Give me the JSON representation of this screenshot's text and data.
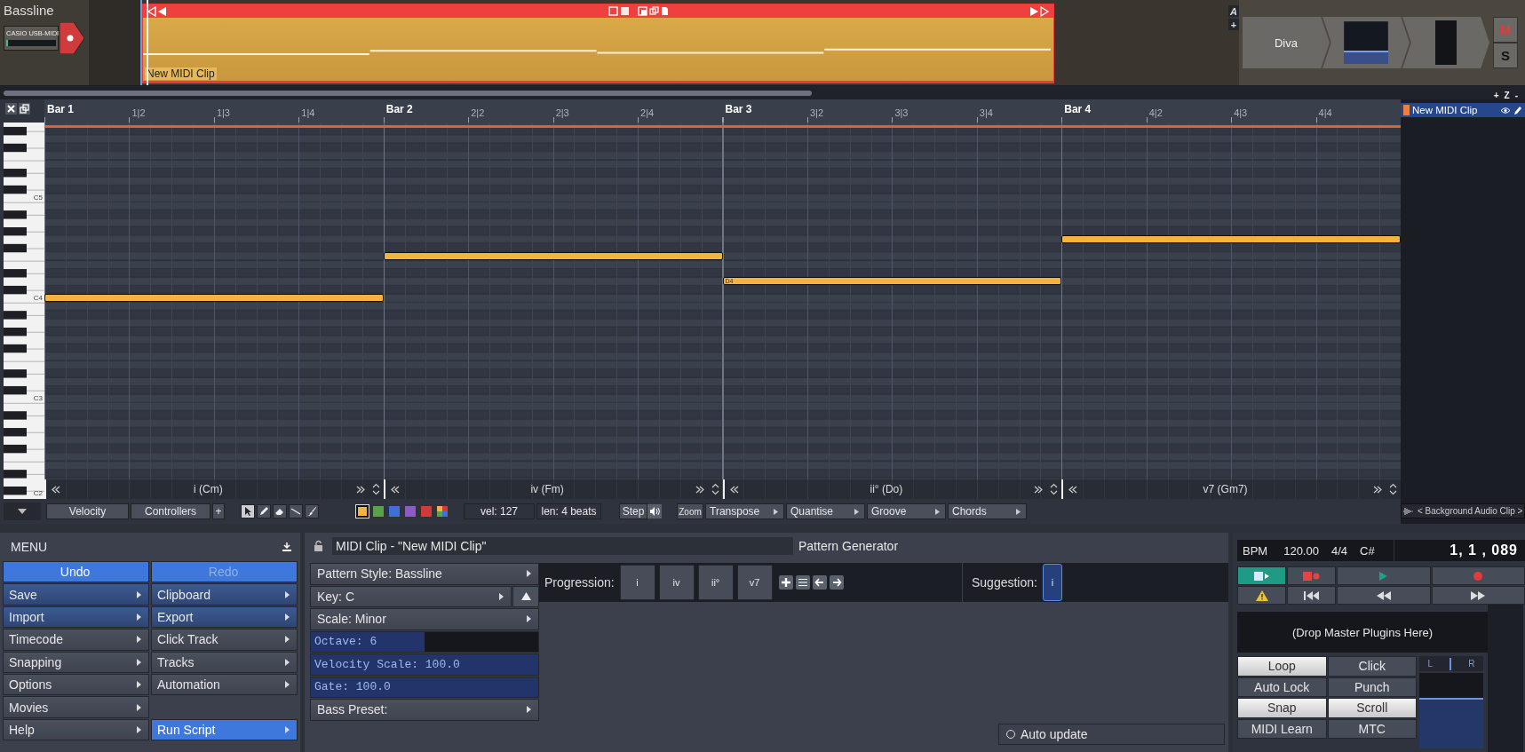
{
  "track": {
    "name": "Bassline",
    "input": "CASIO USB-MIDI",
    "armed": true,
    "clip": {
      "name": "New MIDI Clip",
      "selected": true
    },
    "track_tools": [
      "A",
      "+"
    ],
    "plugins": [
      {
        "kind": "instrument",
        "name": "Diva"
      },
      {
        "kind": "volume"
      },
      {
        "kind": "meter"
      }
    ],
    "mute": {
      "label": "M",
      "on": true
    },
    "solo": {
      "label": "S",
      "on": false
    }
  },
  "zoom_controls": [
    "+",
    "Z",
    "-"
  ],
  "ruler": [
    {
      "label": "Bar 1",
      "kind": "bar"
    },
    {
      "label": "1|2",
      "kind": "beat"
    },
    {
      "label": "1|3",
      "kind": "beat"
    },
    {
      "label": "1|4",
      "kind": "beat"
    },
    {
      "label": "Bar 2",
      "kind": "bar"
    },
    {
      "label": "2|2",
      "kind": "beat"
    },
    {
      "label": "2|3",
      "kind": "beat"
    },
    {
      "label": "2|4",
      "kind": "beat"
    },
    {
      "label": "Bar 3",
      "kind": "bar"
    },
    {
      "label": "3|2",
      "kind": "beat"
    },
    {
      "label": "3|3",
      "kind": "beat"
    },
    {
      "label": "3|4",
      "kind": "beat"
    },
    {
      "label": "Bar 4",
      "kind": "bar"
    },
    {
      "label": "4|2",
      "kind": "beat"
    },
    {
      "label": "4|3",
      "kind": "beat"
    },
    {
      "label": "4|4",
      "kind": "beat"
    }
  ],
  "piano_labels": [
    "C5",
    "C4",
    "C3",
    "C2"
  ],
  "note_label": "D4",
  "chords": [
    "i (Cm)",
    "iv (Fm)",
    "ii° (Do)",
    "v7 (Gm7)"
  ],
  "toolbar": {
    "lanes": [
      "Velocity",
      "Controllers",
      "+"
    ],
    "tools": [
      {
        "kind": "pointer",
        "selected": true
      },
      {
        "kind": "pencil",
        "selected": false
      },
      {
        "kind": "eraser",
        "selected": false
      },
      {
        "kind": "line",
        "selected": false
      },
      {
        "kind": "brush",
        "selected": false
      }
    ],
    "swatches": [
      {
        "kind": "solid",
        "color": "#f2b43e",
        "selected": true
      },
      {
        "kind": "solid",
        "color": "#5aa14c",
        "selected": false
      },
      {
        "kind": "solid",
        "color": "#3f6fd8",
        "selected": false
      },
      {
        "kind": "solid",
        "color": "#8a5cc8",
        "selected": false
      },
      {
        "kind": "solid",
        "color": "#d33a3a",
        "selected": false
      },
      {
        "kind": "multi",
        "selected": false
      }
    ],
    "velocity": "vel: 127",
    "length": "len: 4 beats",
    "step": "Step",
    "zoom": "Zoom",
    "menus": [
      "Transpose",
      "Quantise",
      "Groove",
      "Chords"
    ]
  },
  "clip_list": [
    {
      "name": "New MIDI Clip",
      "selected": true,
      "color": "#f0803c"
    }
  ],
  "background_clip": "< Background Audio Clip >",
  "menu": {
    "title": "MENU",
    "items": [
      {
        "label": "Undo",
        "kind": "accent",
        "submenu": false,
        "disabled": false
      },
      {
        "label": "Redo",
        "kind": "accent",
        "submenu": false,
        "disabled": true
      },
      {
        "label": "Save",
        "kind": "blue",
        "submenu": true,
        "disabled": false
      },
      {
        "label": "Clipboard",
        "kind": "blue",
        "submenu": true,
        "disabled": false
      },
      {
        "label": "Import",
        "kind": "blue",
        "submenu": true,
        "disabled": false
      },
      {
        "label": "Export",
        "kind": "blue",
        "submenu": true,
        "disabled": false
      },
      {
        "label": "Timecode",
        "kind": "plain",
        "submenu": true,
        "disabled": false
      },
      {
        "label": "Click Track",
        "kind": "plain",
        "submenu": true,
        "disabled": false
      },
      {
        "label": "Snapping",
        "kind": "plain",
        "submenu": true,
        "disabled": false
      },
      {
        "label": "Tracks",
        "kind": "plain",
        "submenu": true,
        "disabled": false
      },
      {
        "label": "Options",
        "kind": "plain",
        "submenu": true,
        "disabled": false
      },
      {
        "label": "Automation",
        "kind": "plain",
        "submenu": true,
        "disabled": false
      },
      {
        "label": "Movies",
        "kind": "plain",
        "submenu": true,
        "disabled": false
      },
      {
        "kind": "empty"
      },
      {
        "label": "Help",
        "kind": "plain",
        "submenu": true,
        "disabled": false
      },
      {
        "label": "Run Script",
        "kind": "accent",
        "submenu": true,
        "disabled": false
      }
    ]
  },
  "clip_panel": {
    "title": "MIDI Clip - \"New MIDI Clip\"",
    "tab": "Pattern Generator",
    "params": [
      {
        "kind": "menu",
        "label": "Pattern Style: Bassline",
        "toggle": false
      },
      {
        "kind": "menu",
        "label": "Key: C",
        "toggle": true
      },
      {
        "kind": "menu",
        "label": "Scale: Minor",
        "toggle": false
      },
      {
        "kind": "slider",
        "label": "Octave: 6",
        "level": 0.5
      },
      {
        "kind": "slider",
        "label": "Velocity Scale: 100.0",
        "level": 1
      },
      {
        "kind": "slider",
        "label": "Gate: 100.0",
        "level": 1
      },
      {
        "kind": "menu",
        "label": "Bass Preset:",
        "toggle": false
      }
    ],
    "progression": {
      "label": "Progression:",
      "chords": [
        "i",
        "iv",
        "ii°",
        "v7"
      ]
    },
    "suggestion": {
      "label": "Suggestion:",
      "chords": [
        {
          "label": "i",
          "selected": true
        }
      ]
    },
    "auto_update": {
      "label": "Auto update",
      "checked": false
    }
  },
  "transport": {
    "bpm_label": "BPM",
    "bpm": "120.00",
    "time_signature": "4/4",
    "key": "C#",
    "position": "1, 1 , 089",
    "buttons": [
      {
        "kind": "auto-play",
        "on": true
      },
      {
        "kind": "auto-record",
        "on": false
      },
      {
        "kind": "play",
        "on": false
      },
      {
        "kind": "record",
        "on": false
      },
      {
        "kind": "warning",
        "on": false
      },
      {
        "kind": "to-start",
        "on": false
      },
      {
        "kind": "rewind",
        "on": false
      },
      {
        "kind": "fast-forward",
        "on": false
      }
    ],
    "drop_zone": "(Drop Master Plugins Here)",
    "toggles": [
      {
        "label": "Loop",
        "on": true
      },
      {
        "label": "Click",
        "on": false
      },
      {
        "label": "Auto Lock",
        "on": false
      },
      {
        "label": "Punch",
        "on": false
      },
      {
        "label": "Snap",
        "on": true
      },
      {
        "label": "Scroll",
        "on": true
      },
      {
        "label": "MIDI Learn",
        "on": false
      },
      {
        "label": "MTC",
        "on": false
      }
    ],
    "master": {
      "left": "L",
      "right": "R",
      "level": 0.65
    }
  }
}
